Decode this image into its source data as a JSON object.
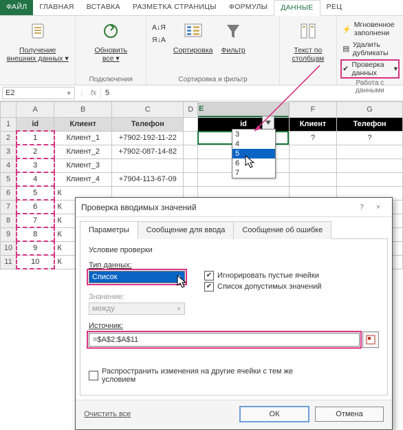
{
  "tabs": {
    "file": "ФАЙЛ",
    "home": "ГЛАВНАЯ",
    "insert": "ВСТАВКА",
    "page": "РАЗМЕТКА СТРАНИЦЫ",
    "formulas": "ФОРМУЛЫ",
    "data": "ДАННЫЕ",
    "rec": "РЕЦ"
  },
  "ribbon": {
    "getdata": "Получение\nвнешних данных ▾",
    "refresh": "Обновить\nвсе ▾",
    "sort_asc": "А↓Я",
    "sort_desc": "Я↓А",
    "sort": "Сортировка",
    "filter": "Фильтр",
    "text_to_cols": "Текст по\nстолбцам",
    "flash": "Мгновенное заполнени",
    "dupes": "Удалить дубликаты",
    "validation": "Проверка данных",
    "vdrop": "▾",
    "grp_conn": "Подключения",
    "grp_sortfilter": "Сортировка и фильтр",
    "grp_datatools": "Работа с данными"
  },
  "namebox": "E2",
  "fx": "fx",
  "formula": "5",
  "cols": [
    "",
    "A",
    "B",
    "C",
    "D",
    "E",
    "F",
    "G"
  ],
  "head1": {
    "A": "id",
    "B": "Клиент",
    "C": "Телефон",
    "E": "id",
    "F": "Клиент",
    "G": "Телефон"
  },
  "rows": [
    {
      "n": "1"
    },
    {
      "n": "2",
      "A": "1",
      "B": "Клиент_1",
      "C": "+7902-192-11-22",
      "E": "5",
      "F": "?",
      "G": "?"
    },
    {
      "n": "3",
      "A": "2",
      "B": "Клиент_2",
      "C": "+7902-087-14-82"
    },
    {
      "n": "4",
      "A": "3",
      "B": "Клиент_3",
      "C": ""
    },
    {
      "n": "5",
      "A": "4",
      "B": "Клиент_4",
      "C": "+7904-113-67-09"
    },
    {
      "n": "6",
      "A": "5",
      "B": "К"
    },
    {
      "n": "7",
      "A": "6",
      "B": "К"
    },
    {
      "n": "8",
      "A": "7",
      "B": "К"
    },
    {
      "n": "9",
      "A": "8",
      "B": "К"
    },
    {
      "n": "10",
      "A": "9",
      "B": "К"
    },
    {
      "n": "11",
      "A": "10",
      "B": "К"
    }
  ],
  "dropdown": {
    "items": [
      "3",
      "4",
      "5",
      "6",
      "7"
    ],
    "selected": "5"
  },
  "dialog": {
    "title": "Проверка вводимых значений",
    "tabs": {
      "params": "Параметры",
      "input_msg": "Сообщение для ввода",
      "error_msg": "Сообщение об ошибке"
    },
    "legend": "Условие проверки",
    "type_lbl": "Тип данных:",
    "type_val": "Список",
    "value_lbl": "Значение:",
    "value_val": "между",
    "ignore": "Игнорировать пустые ячейки",
    "list": "Список допустимых значений",
    "source_lbl": "Источник:",
    "source_val": "=$A$2:$A$11",
    "apply": "Распространить изменения на другие ячейки с тем же условием",
    "clear": "Очистить все",
    "ok": "ОК",
    "cancel": "Отмена",
    "help": "?",
    "close": "×"
  }
}
